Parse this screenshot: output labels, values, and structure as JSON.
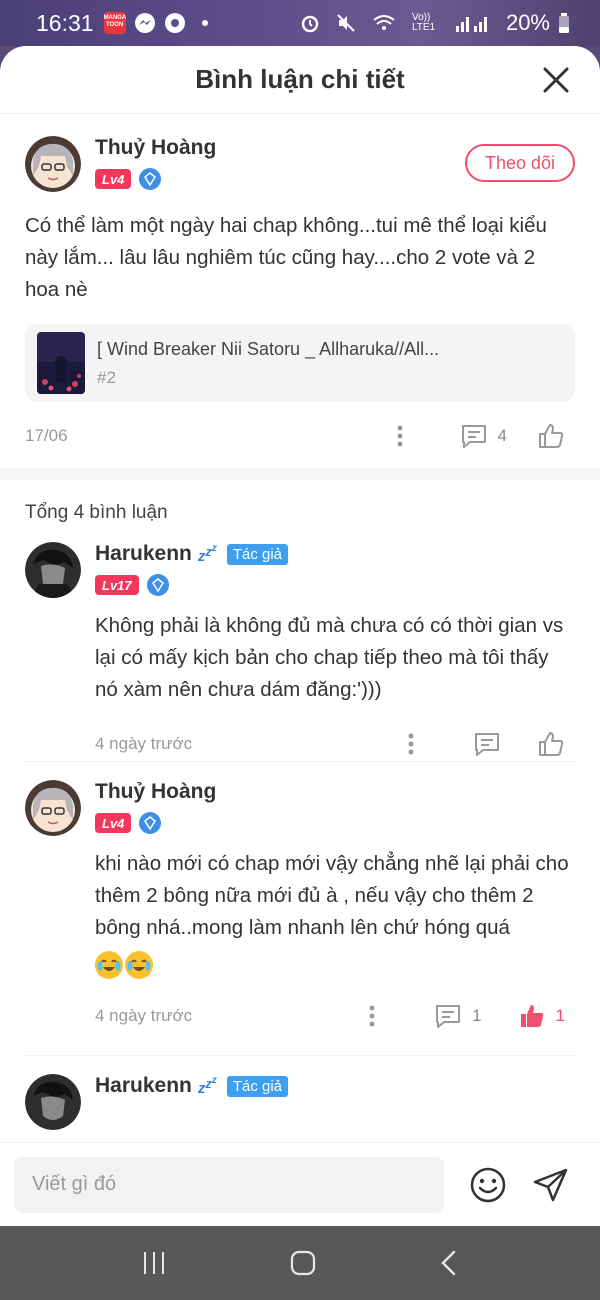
{
  "status_bar": {
    "time": "16:31",
    "app_badge": "MANGA TOON",
    "network": "Vo)) LTE1",
    "battery": "20%"
  },
  "header": {
    "title": "Bình luận chi tiết"
  },
  "main_comment": {
    "username": "Thuỷ Hoàng",
    "level": "Lv4",
    "follow_label": "Theo dõi",
    "text": "Có thể làm một ngày hai chap không...tui mê thể loại kiểu này lắm... lâu lâu nghiêm túc cũng hay....cho 2 vote và 2 hoa nè",
    "story": {
      "title": "[ Wind Breaker Nii Satoru _ Allharuka//All...",
      "chapter": "#2"
    },
    "date": "17/06",
    "reply_count": "4"
  },
  "replies": {
    "total": "Tổng 4 bình luận",
    "items": [
      {
        "username": "Harukenn",
        "author_tag": "Tác giả",
        "level": "Lv17",
        "text": "Không phải là không đủ mà chưa có có thời gian vs lại có mấy kịch bản cho chap tiếp theo mà tôi thấy nó xàm nên chưa dám đăng:')))",
        "time": "4 ngày trước"
      },
      {
        "username": "Thuỷ Hoàng",
        "level": "Lv4",
        "text": "khi nào mới có chap mới vậy chẳng nhẽ lại phải cho thêm 2 bông nữa mới đủ à , nếu vậy cho thêm 2 bông nhá..mong làm nhanh lên chứ hóng quá",
        "time": "4 ngày trước",
        "reply_count": "1",
        "like_count": "1"
      },
      {
        "username": "Harukenn",
        "author_tag": "Tác giả"
      }
    ]
  },
  "input": {
    "placeholder": "Viết gì đó"
  },
  "colors": {
    "accent": "#ef4e6c",
    "level_badge": "#f2375c",
    "author_tag": "#3d9ff0"
  }
}
